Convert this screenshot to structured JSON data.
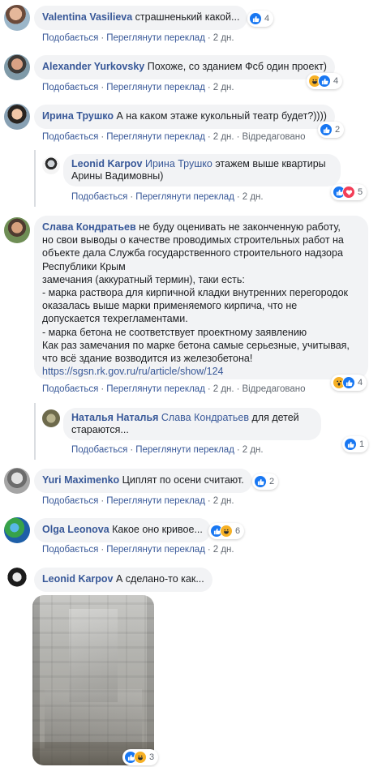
{
  "actions": {
    "like": "Подобається",
    "translate": "Переглянути переклад",
    "reply": "Відредаговано"
  },
  "comments": [
    {
      "author": "Valentina Vasilieva",
      "text": "страшненький какой...",
      "time": "2 дн.",
      "reactions": {
        "types": [
          "like"
        ],
        "count": "4"
      }
    },
    {
      "author": "Alexander Yurkovsky",
      "text": "Похоже, со зданием Фсб один проект)",
      "time": "2 дн.",
      "reactions": {
        "types": [
          "haha",
          "like"
        ],
        "count": "4"
      }
    },
    {
      "author": "Ирина Трушко",
      "text": "А на каком этаже кукольный театр будет?))))",
      "time": "2 дн.",
      "edited": "Відредаговано",
      "reactions": {
        "types": [
          "like"
        ],
        "count": "2"
      }
    },
    {
      "author": "Leonid Karpov",
      "tag": "Ирина Трушко",
      "text": "этажем выше квартиры Арины Вадимовны)",
      "time": "2 дн.",
      "reactions": {
        "types": [
          "like",
          "love"
        ],
        "count": "5"
      }
    },
    {
      "author": "Слава Кондратьев",
      "text_lines": [
        "не буду оценивать не законченную работу,",
        "но свои выводы о качестве проводимых строительных работ на",
        "объекте дала Служба государственного строительного надзора",
        "Республики Крым",
        "замечания (аккуратный термин), таки есть:",
        "- марка раствора для кирпичной кладки внутренних перегородок",
        "оказалась выше марки применяемого кирпича, что не",
        "допускается техрегламентами.",
        "- марка бетона не соответствует проектному заявлению",
        "Как раз замечания по марке бетона самые серьезные, учитывая,",
        "что всё здание возводится из железобетона!"
      ],
      "link": "https://sgsn.rk.gov.ru/ru/article/show/124",
      "time": "2 дн.",
      "edited": "Відредаговано",
      "reactions": {
        "types": [
          "wow",
          "like"
        ],
        "count": "4"
      }
    },
    {
      "author": "Наталья Наталья",
      "tag": "Слава Кондратьев",
      "text": "для детей",
      "text2": "стараются...",
      "time": "2 дн.",
      "reactions": {
        "types": [
          "like"
        ],
        "count": "1"
      }
    },
    {
      "author": "Yuri Maximenko",
      "text": "Циплят по осени считают.",
      "time": "2 дн.",
      "reactions": {
        "types": [
          "like"
        ],
        "count": "2"
      }
    },
    {
      "author": "Olga Leonova",
      "text": "Какое оно кривое...",
      "time": "2 дн.",
      "reactions": {
        "types": [
          "like",
          "haha"
        ],
        "count": "6"
      }
    },
    {
      "author": "Leonid Karpov",
      "text": "А сделано-то как...",
      "reactions": {
        "types": [
          "like",
          "haha"
        ],
        "count": "3"
      }
    }
  ],
  "colors": {
    "link": "#385898",
    "bubble": "#f2f3f5",
    "like": "#1877f2",
    "haha": "#f7b125",
    "love": "#f33e58"
  }
}
